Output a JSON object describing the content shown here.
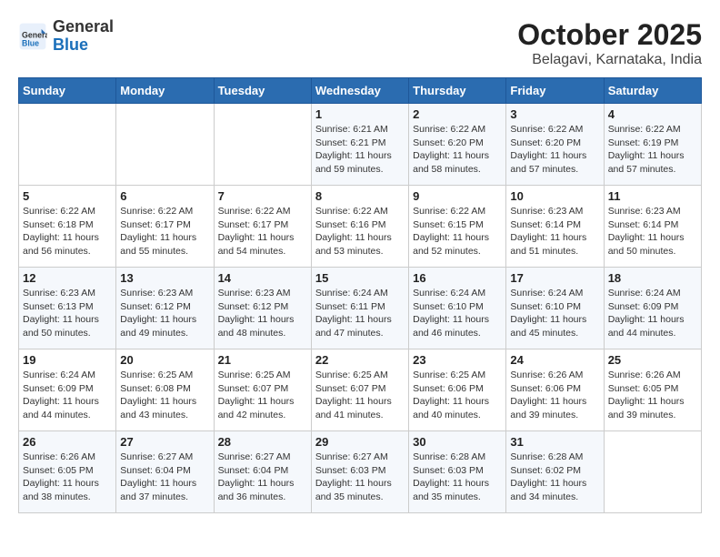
{
  "header": {
    "logo_general": "General",
    "logo_blue": "Blue",
    "month": "October 2025",
    "location": "Belagavi, Karnataka, India"
  },
  "weekdays": [
    "Sunday",
    "Monday",
    "Tuesday",
    "Wednesday",
    "Thursday",
    "Friday",
    "Saturday"
  ],
  "weeks": [
    [
      {
        "day": "",
        "info": ""
      },
      {
        "day": "",
        "info": ""
      },
      {
        "day": "",
        "info": ""
      },
      {
        "day": "1",
        "info": "Sunrise: 6:21 AM\nSunset: 6:21 PM\nDaylight: 11 hours\nand 59 minutes."
      },
      {
        "day": "2",
        "info": "Sunrise: 6:22 AM\nSunset: 6:20 PM\nDaylight: 11 hours\nand 58 minutes."
      },
      {
        "day": "3",
        "info": "Sunrise: 6:22 AM\nSunset: 6:20 PM\nDaylight: 11 hours\nand 57 minutes."
      },
      {
        "day": "4",
        "info": "Sunrise: 6:22 AM\nSunset: 6:19 PM\nDaylight: 11 hours\nand 57 minutes."
      }
    ],
    [
      {
        "day": "5",
        "info": "Sunrise: 6:22 AM\nSunset: 6:18 PM\nDaylight: 11 hours\nand 56 minutes."
      },
      {
        "day": "6",
        "info": "Sunrise: 6:22 AM\nSunset: 6:17 PM\nDaylight: 11 hours\nand 55 minutes."
      },
      {
        "day": "7",
        "info": "Sunrise: 6:22 AM\nSunset: 6:17 PM\nDaylight: 11 hours\nand 54 minutes."
      },
      {
        "day": "8",
        "info": "Sunrise: 6:22 AM\nSunset: 6:16 PM\nDaylight: 11 hours\nand 53 minutes."
      },
      {
        "day": "9",
        "info": "Sunrise: 6:22 AM\nSunset: 6:15 PM\nDaylight: 11 hours\nand 52 minutes."
      },
      {
        "day": "10",
        "info": "Sunrise: 6:23 AM\nSunset: 6:14 PM\nDaylight: 11 hours\nand 51 minutes."
      },
      {
        "day": "11",
        "info": "Sunrise: 6:23 AM\nSunset: 6:14 PM\nDaylight: 11 hours\nand 50 minutes."
      }
    ],
    [
      {
        "day": "12",
        "info": "Sunrise: 6:23 AM\nSunset: 6:13 PM\nDaylight: 11 hours\nand 50 minutes."
      },
      {
        "day": "13",
        "info": "Sunrise: 6:23 AM\nSunset: 6:12 PM\nDaylight: 11 hours\nand 49 minutes."
      },
      {
        "day": "14",
        "info": "Sunrise: 6:23 AM\nSunset: 6:12 PM\nDaylight: 11 hours\nand 48 minutes."
      },
      {
        "day": "15",
        "info": "Sunrise: 6:24 AM\nSunset: 6:11 PM\nDaylight: 11 hours\nand 47 minutes."
      },
      {
        "day": "16",
        "info": "Sunrise: 6:24 AM\nSunset: 6:10 PM\nDaylight: 11 hours\nand 46 minutes."
      },
      {
        "day": "17",
        "info": "Sunrise: 6:24 AM\nSunset: 6:10 PM\nDaylight: 11 hours\nand 45 minutes."
      },
      {
        "day": "18",
        "info": "Sunrise: 6:24 AM\nSunset: 6:09 PM\nDaylight: 11 hours\nand 44 minutes."
      }
    ],
    [
      {
        "day": "19",
        "info": "Sunrise: 6:24 AM\nSunset: 6:09 PM\nDaylight: 11 hours\nand 44 minutes."
      },
      {
        "day": "20",
        "info": "Sunrise: 6:25 AM\nSunset: 6:08 PM\nDaylight: 11 hours\nand 43 minutes."
      },
      {
        "day": "21",
        "info": "Sunrise: 6:25 AM\nSunset: 6:07 PM\nDaylight: 11 hours\nand 42 minutes."
      },
      {
        "day": "22",
        "info": "Sunrise: 6:25 AM\nSunset: 6:07 PM\nDaylight: 11 hours\nand 41 minutes."
      },
      {
        "day": "23",
        "info": "Sunrise: 6:25 AM\nSunset: 6:06 PM\nDaylight: 11 hours\nand 40 minutes."
      },
      {
        "day": "24",
        "info": "Sunrise: 6:26 AM\nSunset: 6:06 PM\nDaylight: 11 hours\nand 39 minutes."
      },
      {
        "day": "25",
        "info": "Sunrise: 6:26 AM\nSunset: 6:05 PM\nDaylight: 11 hours\nand 39 minutes."
      }
    ],
    [
      {
        "day": "26",
        "info": "Sunrise: 6:26 AM\nSunset: 6:05 PM\nDaylight: 11 hours\nand 38 minutes."
      },
      {
        "day": "27",
        "info": "Sunrise: 6:27 AM\nSunset: 6:04 PM\nDaylight: 11 hours\nand 37 minutes."
      },
      {
        "day": "28",
        "info": "Sunrise: 6:27 AM\nSunset: 6:04 PM\nDaylight: 11 hours\nand 36 minutes."
      },
      {
        "day": "29",
        "info": "Sunrise: 6:27 AM\nSunset: 6:03 PM\nDaylight: 11 hours\nand 35 minutes."
      },
      {
        "day": "30",
        "info": "Sunrise: 6:28 AM\nSunset: 6:03 PM\nDaylight: 11 hours\nand 35 minutes."
      },
      {
        "day": "31",
        "info": "Sunrise: 6:28 AM\nSunset: 6:02 PM\nDaylight: 11 hours\nand 34 minutes."
      },
      {
        "day": "",
        "info": ""
      }
    ]
  ]
}
